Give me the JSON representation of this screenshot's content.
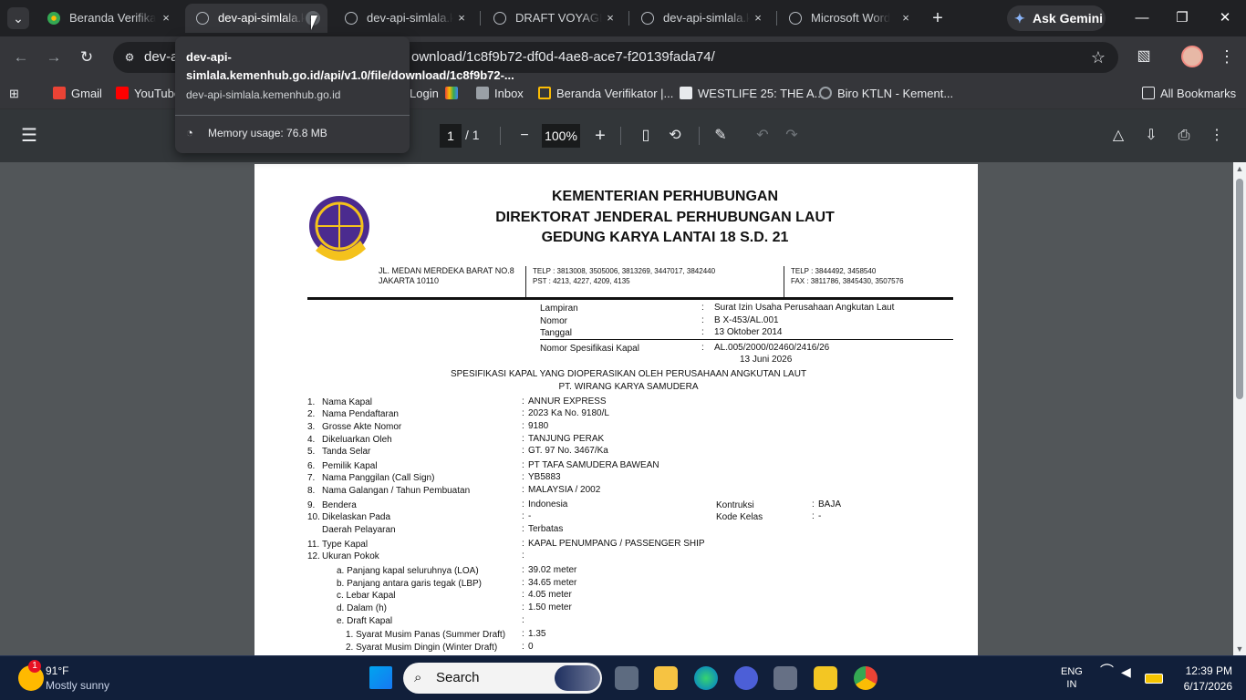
{
  "browser": {
    "tabs": [
      {
        "title": "Beranda Verifikator",
        "active": false
      },
      {
        "title": "dev-api-simlala.kemenhub",
        "active": true
      },
      {
        "title": "dev-api-simlala.kemenhub",
        "active": false
      },
      {
        "title": "DRAFT VOYAGE PERMIT",
        "active": false
      },
      {
        "title": "dev-api-simlala.kemenhub",
        "active": false
      },
      {
        "title": "Microsoft Word",
        "active": false
      }
    ],
    "new_tab_label": "+",
    "gemini_label": "Ask Gemini",
    "url_visible": "dev-api-simlala.kemenhub.go.id/api/v1.0/file/download/1c8f9b72-df0d-4ae8-ace7-f20139fada74/",
    "url_left": "dev-a",
    "url_right": "ownload/1c8f9b72-df0d-4ae8-ace7-f20139fada74/",
    "bookmarks": [
      "Gmail",
      "YouTube",
      "Login",
      "Inbox",
      "Beranda Verifikator |...",
      "WESTLIFE 25: THE A...",
      "Biro KTLN - Kement..."
    ],
    "all_bookmarks": "All Bookmarks",
    "hovercard": {
      "title": "dev-api-simlala.kemenhub.go.id/api/v1.0/file/download/1c8f9b72-...",
      "host": "dev-api-simlala.kemenhub.go.id",
      "memory": "Memory usage: 76.8 MB"
    }
  },
  "pdf_toolbar": {
    "page_current": "1",
    "page_total": "/ 1",
    "zoom": "100%"
  },
  "document": {
    "heading": [
      "KEMENTERIAN PERHUBUNGAN",
      "DIREKTORAT JENDERAL PERHUBUNGAN LAUT",
      "GEDUNG KARYA LANTAI 18 S.D. 21"
    ],
    "address": [
      "JL. MEDAN MERDEKA BARAT NO.8",
      "JAKARTA 10110"
    ],
    "telp_left": [
      "TELP :  3813008, 3505006, 3813269, 3447017, 3842440",
      "PST  :  4213, 4227, 4209, 4135"
    ],
    "telp_right": [
      "TELP :  3844492, 3458540",
      "FAX  :  3811786, 3845430, 3507576"
    ],
    "meta": [
      {
        "label": "Lampiran",
        "value": "Surat Izin Usaha Perusahaan Angkutan Laut"
      },
      {
        "label": "Nomor",
        "value": "B X-453/AL.001"
      },
      {
        "label": "Tanggal",
        "value": "13 Oktober 2014"
      },
      {
        "label": "Nomor Spesifikasi Kapal",
        "value": "AL.005/2000/02460/2416/26"
      }
    ],
    "spec_date": "13 Juni 2026",
    "title": "SPESIFIKASI KAPAL YANG DIOPERASIKAN OLEH PERUSAHAAN ANGKUTAN LAUT",
    "company": "PT. WIRANG KARYA SAMUDERA",
    "rows": [
      {
        "n": "1.",
        "label": "Nama Kapal",
        "value": "ANNUR EXPRESS"
      },
      {
        "n": "2.",
        "label": "Nama Pendaftaran",
        "value": "2023 Ka No. 9180/L"
      },
      {
        "n": "3.",
        "label": "Grosse Akte Nomor",
        "value": "9180"
      },
      {
        "n": "4.",
        "label": "Dikeluarkan Oleh",
        "value": "TANJUNG PERAK"
      },
      {
        "n": "5.",
        "label": "Tanda Selar",
        "value": "GT. 97 No. 3467/Ka"
      },
      {
        "n": "6.",
        "label": "Pemilik Kapal",
        "value": "PT TAFA SAMUDERA BAWEAN"
      },
      {
        "n": "7.",
        "label": "Nama Panggilan (Call Sign)",
        "value": "YB5883"
      },
      {
        "n": "8.",
        "label": "Nama Galangan / Tahun Pembuatan",
        "value": "MALAYSIA / 2002"
      },
      {
        "n": "9.",
        "label": "Bendera",
        "value": "Indonesia"
      },
      {
        "n": "10.",
        "label": "Dikelaskan Pada",
        "value": "-"
      },
      {
        "n": "",
        "label": "Daerah Pelayaran",
        "value": "Terbatas"
      },
      {
        "n": "11.",
        "label": "Type Kapal",
        "value": "KAPAL PENUMPANG / PASSENGER SHIP"
      },
      {
        "n": "12.",
        "label": "Ukuran Pokok",
        "value": ""
      },
      {
        "n": "",
        "label": "a. Panjang kapal seluruhnya (LOA)",
        "value": "39.02 meter"
      },
      {
        "n": "",
        "label": "b. Panjang antara garis tegak (LBP)",
        "value": "34.65 meter"
      },
      {
        "n": "",
        "label": "c. Lebar Kapal",
        "value": "4.05 meter"
      },
      {
        "n": "",
        "label": "d. Dalam (h)",
        "value": "1.50 meter"
      },
      {
        "n": "",
        "label": "e. Draft Kapal",
        "value": ""
      },
      {
        "n": "",
        "label": "1. Syarat Musim Panas (Summer Draft)",
        "value": "1.35"
      },
      {
        "n": "",
        "label": "2. Syarat Musim Dingin (Winter Draft)",
        "value": "0"
      }
    ],
    "extra": [
      {
        "label": "Kontruksi",
        "value": "BAJA"
      },
      {
        "label": "Kode Kelas",
        "value": "-"
      }
    ]
  },
  "taskbar": {
    "weather_badge": "1",
    "temp": "91°F",
    "weather": "Mostly sunny",
    "search": "Search",
    "lang_top": "ENG",
    "lang_bottom": "IN",
    "time": "12:39 PM",
    "date": "6/17/2026"
  }
}
